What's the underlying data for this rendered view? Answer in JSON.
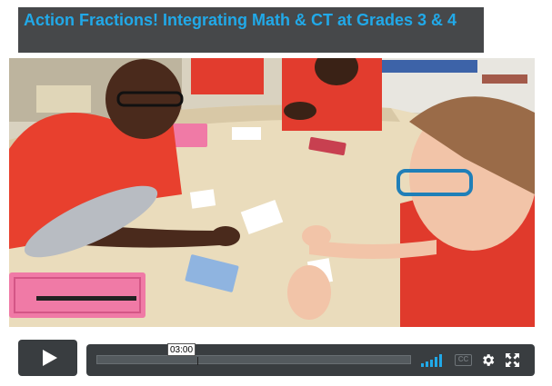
{
  "video": {
    "title": "Action Fractions! Integrating Math & CT at Grades 3 & 4"
  },
  "player": {
    "hover_time": "03:00",
    "accent_color": "#21a9e8",
    "controls": {
      "play_icon": "play-icon",
      "volume_icon": "volume-bars-icon",
      "captions_label": "CC",
      "settings_icon": "gear-icon",
      "fullscreen_icon": "fullscreen-icon"
    }
  }
}
